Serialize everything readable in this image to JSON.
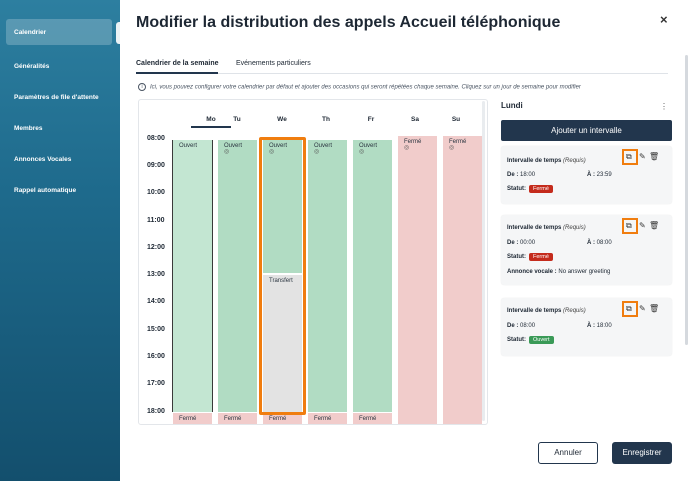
{
  "sidebar": {
    "items": [
      {
        "label": "Calendrier",
        "active": true
      },
      {
        "label": "Généralités"
      },
      {
        "label": "Paramètres de file d'attente"
      },
      {
        "label": "Membres"
      },
      {
        "label": "Annonces Vocales"
      },
      {
        "label": "Rappel automatique"
      }
    ]
  },
  "modal": {
    "title": "Modifier la distribution des appels Accueil téléphonique",
    "close_label": "×"
  },
  "tabs": [
    {
      "label": "Calendrier de la semaine",
      "active": true
    },
    {
      "label": "Evénements particuliers"
    }
  ],
  "info_text": "Ici, vous pouvez configurer votre calendrier par défaut et ajouter des occasions qui seront répétées chaque semaine. Cliquez sur un jour de semaine pour modifier",
  "calendar": {
    "days": [
      "Mo",
      "Tu",
      "We",
      "Th",
      "Fr",
      "Sa",
      "Su"
    ],
    "selected_day": "Mo",
    "hours": [
      "08:00",
      "09:00",
      "10:00",
      "11:00",
      "12:00",
      "13:00",
      "14:00",
      "15:00",
      "16:00",
      "17:00",
      "18:00"
    ],
    "blocks": {
      "mo_open": "Ouvert",
      "tu_open": "Ouvert",
      "we_open": "Ouvert",
      "we_transfer": "Transfert",
      "th_open": "Ouvert",
      "fr_open": "Ouvert",
      "sa_closed": "Fermé",
      "su_closed": "Fermé",
      "mo_closed": "Fermé",
      "tu_closed": "Fermé",
      "we_closed": "Fermé",
      "th_closed": "Fermé",
      "fr_closed": "Fermé"
    },
    "status_icon": "◎"
  },
  "panel": {
    "day_title": "Lundi",
    "menu_icon": "⋮",
    "add_button": "Ajouter un intervalle",
    "intervals": [
      {
        "title": "Intervalle de temps",
        "required": "(Requis)",
        "from_label": "De :",
        "from": "18:00",
        "to_label": "À :",
        "to": "23:59",
        "status_label": "Statut:",
        "status": "Fermé",
        "status_color": "#c42b1c"
      },
      {
        "title": "Intervalle de temps",
        "required": "(Requis)",
        "from_label": "De :",
        "from": "00:00",
        "to_label": "À :",
        "to": "08:00",
        "status_label": "Statut:",
        "status": "Fermé",
        "status_color": "#c42b1c",
        "announce_label": "Annonce vocale :",
        "announce": "No answer greeting"
      },
      {
        "title": "Intervalle de temps",
        "required": "(Requis)",
        "from_label": "De :",
        "from": "08:00",
        "to_label": "À :",
        "to": "18:00",
        "status_label": "Statut:",
        "status": "Ouvert",
        "status_color": "#3a9a57"
      }
    ],
    "icons": {
      "copy": "copy-icon",
      "edit": "pencil-icon",
      "delete": "trash-icon"
    }
  },
  "footer": {
    "cancel": "Annuler",
    "save": "Enregistrer"
  },
  "colors": {
    "primary": "#22364d",
    "highlight": "#f07d0f",
    "open": "#b1dcc3",
    "closed": "#f1cccb",
    "transfer": "#e3e3e3"
  }
}
